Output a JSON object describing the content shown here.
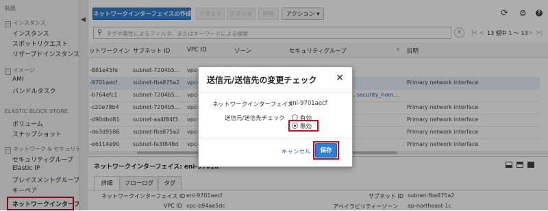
{
  "sidebar": {
    "top_item": "制限",
    "groups": [
      {
        "title": "インスタンス",
        "items": [
          "インスタンス",
          "スポットリクエスト",
          "リザーブドインスタンス"
        ]
      },
      {
        "title": "イメージ",
        "items": [
          "AMI",
          "バンドルタスク"
        ]
      },
      {
        "title": "ELASTIC BLOCK STORE",
        "items": [
          "ボリューム",
          "スナップショット"
        ]
      },
      {
        "title": "ネットワーク & セキュリティ",
        "items": [
          "セキュリティグループ",
          "Elastic IP",
          "プレイスメントグループ",
          "キーペア",
          "ネットワークインターフェイス"
        ]
      }
    ]
  },
  "toolbar": {
    "create_label": "ネットワークインターフェイスの作成",
    "attach_label": "アタッチ",
    "detach_label": "デタッチ",
    "delete_label": "削除",
    "actions_label": "アクション"
  },
  "search": {
    "placeholder": "タグや属性によるフィルタ、またはキーワードによる検索",
    "pagination": "13 個中 1 ～ 13"
  },
  "table": {
    "columns": [
      "ットワークイン",
      "サブネット ID",
      "VPC ID",
      "ゾーン",
      "セキュリティグループ",
      "説明"
    ],
    "rows": [
      {
        "eni": "-881e45fe",
        "subnet": "subnet-7204b5...",
        "vpc": "vpc-",
        "sg": "",
        "desc": ""
      },
      {
        "eni": "-9701aecf",
        "subnet": "subnet-fba875a2",
        "vpc": "vpc-",
        "sg": "",
        "desc": "Primary network interface"
      },
      {
        "eni": "-b764efc1",
        "subnet": "subnet-7204b5...",
        "vpc": "vpc-",
        "sg": "..., security_hom...",
        "desc": ""
      },
      {
        "eni": "-c20e78b4",
        "subnet": "subnet-7204b5...",
        "vpc": "vpc-",
        "sg": "",
        "desc": "Primary network interface"
      },
      {
        "eni": "-d90dbd81",
        "subnet": "subnet-aa4f84f3",
        "vpc": "vpc-",
        "sg": "",
        "desc": "Primary network interface"
      },
      {
        "eni": "-de3d9586",
        "subnet": "subnet-fba875a2",
        "vpc": "vpc-",
        "sg": "",
        "desc": "Primary network interface"
      },
      {
        "eni": "-e6114e90",
        "subnet": "subnet-fa3f848d",
        "vpc": "vpc-",
        "sg": "",
        "desc": "Primary network interface"
      }
    ]
  },
  "detail": {
    "header": "ネットワークインターフェイス: eni-9701a",
    "tabs": [
      "詳細",
      "フローログ",
      "タグ"
    ],
    "fields": {
      "eni_label": "ネットワークインターフェイス ID",
      "eni_value": "eni-9701aecf",
      "subnet_label": "サブネット ID",
      "subnet_value": "subnet-fba875a2",
      "vpc_label": "VPC ID",
      "vpc_value": "vpc-b94ae5dc",
      "az_label": "アベイラビリティーゾーン",
      "az_value": "ap-northeast-1c"
    }
  },
  "modal": {
    "title": "送信元/送信先の変更チェック",
    "eni_label": "ネットワークインターフェイス",
    "eni_value": "eni-9701aecf",
    "check_label": "送信元/送信先チェック",
    "option_enabled": "有効",
    "option_disabled": "無効",
    "selected": "無効",
    "cancel_label": "キャンセル",
    "save_label": "保存"
  },
  "colors": {
    "primary": "#2c7fd3",
    "highlight": "#d9001b",
    "link": "#1f67b1"
  }
}
